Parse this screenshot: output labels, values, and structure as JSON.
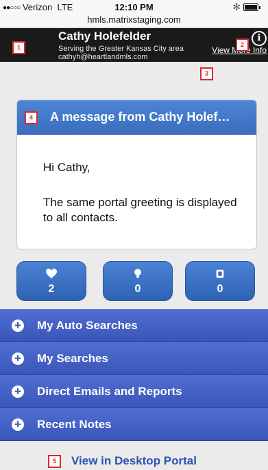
{
  "status": {
    "carrier": "Verizon",
    "network": "LTE",
    "time": "12:10 PM",
    "bluetooth": "✻"
  },
  "url": "hmls.matrixstaging.com",
  "header": {
    "agent_name": "Cathy Holefelder",
    "serving": "Serving the Greater Kansas City area",
    "email": "cathyh@heartlandmls.com",
    "more_info": "View More Info",
    "info_icon": "i"
  },
  "message": {
    "title": "A message from Cathy Holef…",
    "greeting": "Hi Cathy,",
    "body": "The same portal greeting is displayed to all contacts."
  },
  "stats": [
    {
      "icon": "heart-icon",
      "count": "2"
    },
    {
      "icon": "lightbulb-icon",
      "count": "0"
    },
    {
      "icon": "trash-icon",
      "count": "0"
    }
  ],
  "sections": [
    {
      "label": "My Auto Searches"
    },
    {
      "label": "My Searches"
    },
    {
      "label": "Direct Emails and Reports"
    },
    {
      "label": "Recent Notes"
    }
  ],
  "desktop_link": "View in Desktop Portal",
  "badges": [
    "1",
    "2",
    "3",
    "4",
    "5"
  ],
  "colors": {
    "header_bg": "#1a1a1a",
    "accent_blue": "#3a6dbd",
    "section_blue": "#3a55b8",
    "badge_red": "#d9282e",
    "page_bg": "#ebebeb"
  }
}
